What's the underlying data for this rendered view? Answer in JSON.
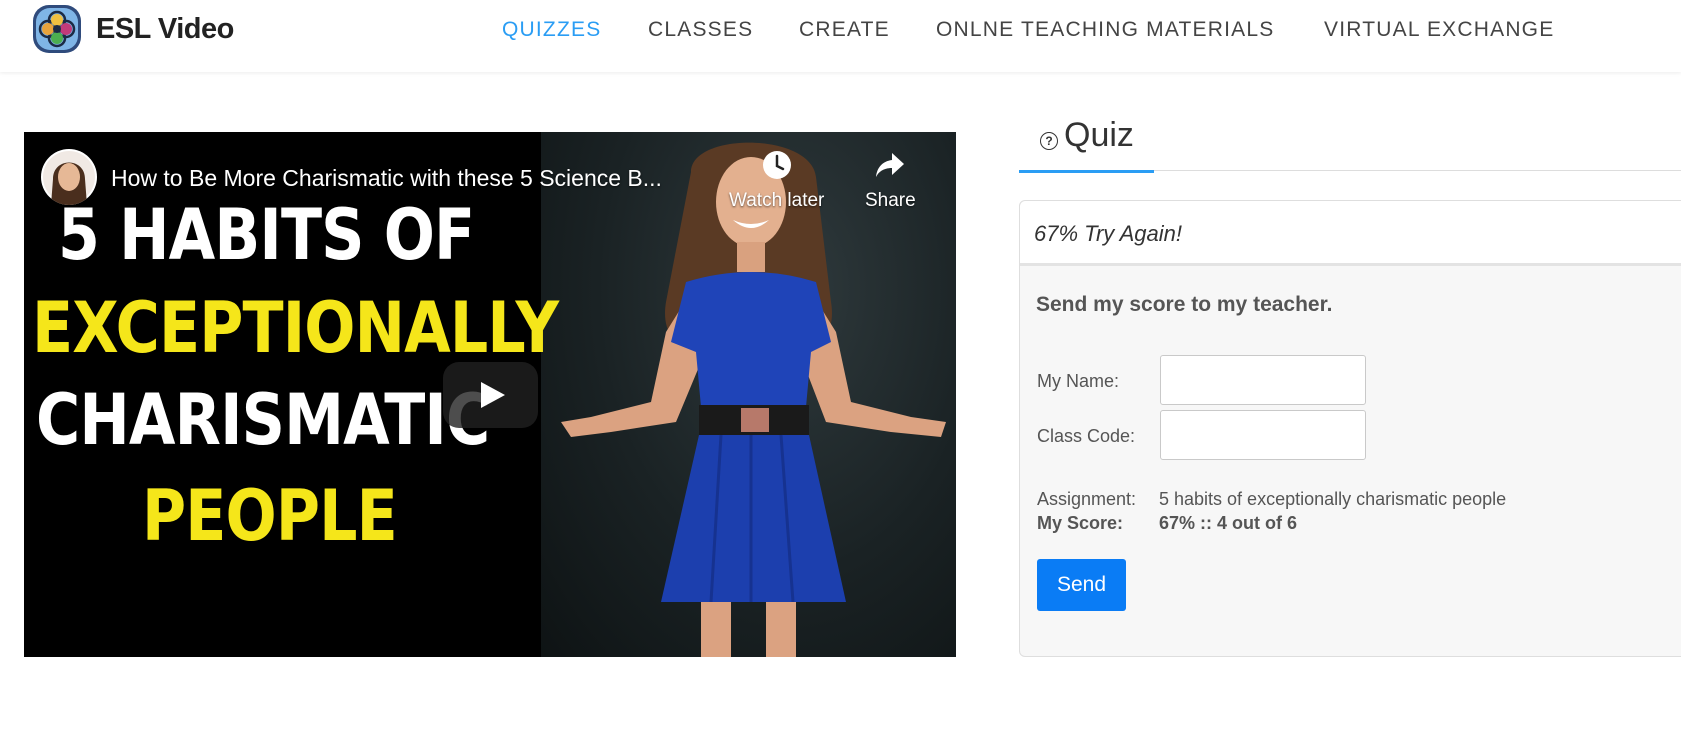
{
  "brand": {
    "name": "ESL Video",
    "logo_icon": "flower-logo-icon",
    "logo_colors": [
      "#2f4b7c",
      "#7fb5e6",
      "#f0c040",
      "#c23b7a",
      "#4caf50"
    ]
  },
  "nav": {
    "items": [
      {
        "label": "QUIZZES",
        "active": true
      },
      {
        "label": "CLASSES",
        "active": false
      },
      {
        "label": "CREATE",
        "active": false
      },
      {
        "label": "ONLNE TEACHING MATERIALS",
        "active": false
      },
      {
        "label": "VIRTUAL EXCHANGE",
        "active": false
      }
    ],
    "active_color": "#2a9df4"
  },
  "video": {
    "title": "How to Be More Charismatic with these 5 Science B...",
    "watch_later_label": "Watch later",
    "share_label": "Share",
    "thumbnail_lines": [
      "5 HABITS OF",
      "EXCEPTIONALLY",
      "CHARISMATIC",
      "PEOPLE"
    ],
    "thumbnail_colors": [
      "#ffffff",
      "#f5e61a"
    ],
    "icons": [
      "clock-icon",
      "share-arrow-icon",
      "play-icon",
      "channel-avatar"
    ]
  },
  "quiz": {
    "tab_label": "Quiz",
    "tab_icon": "question-circle-icon",
    "score_message": "67% Try Again!",
    "send_heading": "Send my score to my teacher.",
    "name_label": "My Name:",
    "name_value": "",
    "class_code_label": "Class Code:",
    "class_code_value": "",
    "assignment_label": "Assignment:",
    "assignment_value": "5 habits of exceptionally charismatic people",
    "score_label": "My Score:",
    "score_value": "67% :: 4 out of 6",
    "send_button": "Send",
    "button_color": "#0a7cf5"
  }
}
